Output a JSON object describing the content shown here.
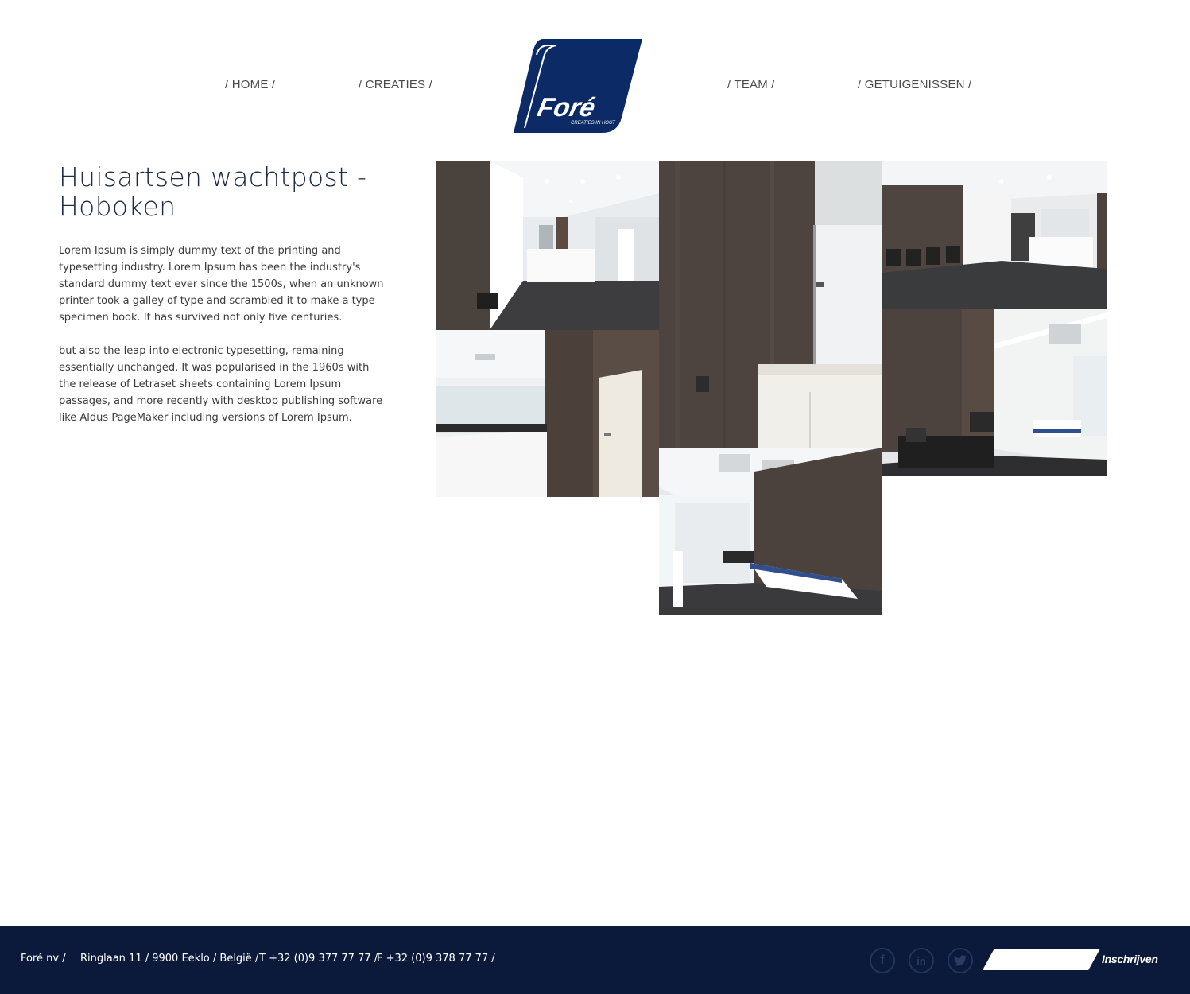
{
  "nav": {
    "home": "/ HOME /",
    "creaties": "/ CREATIES /",
    "team": "/ TEAM /",
    "getuigenissen": "/ GETUIGENISSEN /"
  },
  "logo": {
    "name": "Foré",
    "tagline": "CREATIES IN HOUT",
    "color": "#0b2a66"
  },
  "article": {
    "title": "Huisartsen wachtpost - Hoboken",
    "paragraphs": [
      "Lorem Ipsum is simply dummy text of the printing and typesetting industry. Lorem Ipsum has been the industry's standard dummy text ever since the 1500s, when an unknown printer took a galley of type and scrambled it to make a type specimen book. It has survived not only five centuries.",
      "but also the leap into electronic typesetting, remaining essentially unchanged. It was popularised in the 1960s with the release of Letraset sheets containing Lorem Ipsum passages, and more recently with desktop publishing software like Aldus PageMaker including versions of Lorem Ipsum."
    ]
  },
  "gallery": {
    "photo_count": 6
  },
  "footer": {
    "company": "Foré nv /",
    "address": "Ringlaan 11 / 9900 Eeklo / België /",
    "phone": "T +32 (0)9 377 77 77 /",
    "fax": "F +32 (0)9 378 77 77 /",
    "social": {
      "facebook": "f",
      "linkedin": "in",
      "twitter": "t"
    },
    "subscribe_label": "Inschrijven",
    "background": "#0b1a3a"
  }
}
